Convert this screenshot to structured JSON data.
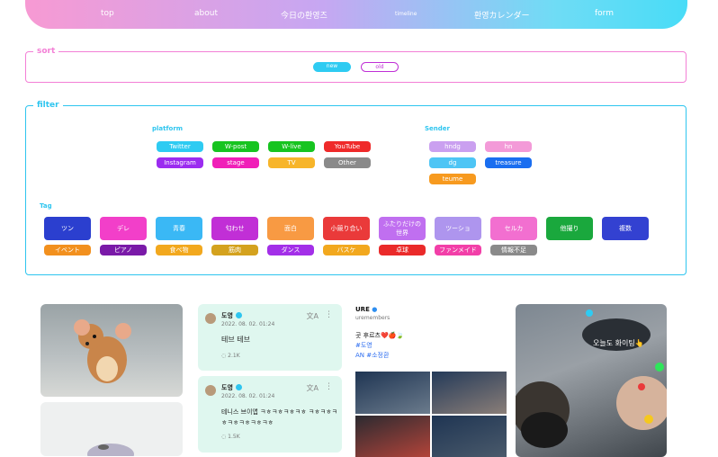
{
  "nav": {
    "items": [
      "top",
      "about",
      "今日の환영즈",
      "timeline",
      "환영カレンダー",
      "form"
    ]
  },
  "sort": {
    "legend": "sort",
    "new_label": "new",
    "old_label": "old"
  },
  "filter": {
    "legend": "filter",
    "platform_label": "platform",
    "platform": [
      {
        "label": "Twitter",
        "color": "#2ecbf2"
      },
      {
        "label": "W-post",
        "color": "#17c420"
      },
      {
        "label": "W-live",
        "color": "#17c420"
      },
      {
        "label": "YouTube",
        "color": "#ef2a2a"
      },
      {
        "label": "Instagram",
        "color": "#9b2cf0"
      },
      {
        "label": "stage",
        "color": "#f01fb8"
      },
      {
        "label": "TV",
        "color": "#f7b52a"
      },
      {
        "label": "Other",
        "color": "#8a8a8a"
      }
    ],
    "sender_label": "Sender",
    "sender": [
      {
        "label": "hndg",
        "color": "#caa0f0"
      },
      {
        "label": "hn",
        "color": "#f39ad8"
      },
      {
        "label": "dg",
        "color": "#4ec5f5"
      },
      {
        "label": "treasure",
        "color": "#1a6ef0"
      },
      {
        "label": "teume",
        "color": "#f79a1f"
      }
    ],
    "tag_label": "Tag",
    "tags_row1": [
      {
        "label": "ツン",
        "color": "#2b3fcf"
      },
      {
        "label": "デレ",
        "color": "#f23fc9"
      },
      {
        "label": "青春",
        "color": "#3ab8f5"
      },
      {
        "label": "匂わせ",
        "color": "#c12fd6"
      },
      {
        "label": "面白",
        "color": "#f89a43"
      },
      {
        "label": "小競り合い",
        "color": "#ea3a3a"
      },
      {
        "label": "ふたりだけの世界",
        "color": "#c06ff0"
      },
      {
        "label": "ツーショ",
        "color": "#ae95ee"
      },
      {
        "label": "セルカ",
        "color": "#f26fd0"
      },
      {
        "label": "他撮り",
        "color": "#1aa83d"
      },
      {
        "label": "複数",
        "color": "#3341d1"
      }
    ],
    "tags_row2": [
      {
        "label": "イベント",
        "color": "#f2901e"
      },
      {
        "label": "ピアノ",
        "color": "#7a1aa8"
      },
      {
        "label": "食べ物",
        "color": "#f2a81e"
      },
      {
        "label": "筋肉",
        "color": "#d4a21e"
      },
      {
        "label": "ダンス",
        "color": "#a32fe8"
      },
      {
        "label": "バスケ",
        "color": "#f2a81e"
      },
      {
        "label": "卓球",
        "color": "#ea2a2a"
      },
      {
        "label": "ファンメイド",
        "color": "#f23fa8"
      },
      {
        "label": "情報不足",
        "color": "#8a8a8a"
      }
    ]
  },
  "posts": {
    "tweet1": {
      "name": "도영",
      "date": "2022. 08. 02. 01:24",
      "text": "테브 테브",
      "likes": "2.1K",
      "translate": "文A",
      "menu": "⋮"
    },
    "tweet2": {
      "name": "도영",
      "date": "2022. 08. 02. 01:24",
      "text": "테니스 브이앱 ㅋㅎㅋㅎㅋㅎㅋㅎ ㅋㅎㅋㅎㅋㅎㅋㅎㅋㅎㅋㅎㅋㅎ",
      "likes": "1.5K",
      "translate": "文A",
      "menu": "⋮"
    },
    "insta": {
      "account": "URE",
      "members": "uremembers",
      "line1": "곳 후르츠❤️🍎🍃",
      "line2": "#도영",
      "line3": "AN #소정환"
    },
    "selfie_caption": "오늘도 화이팅👆"
  }
}
